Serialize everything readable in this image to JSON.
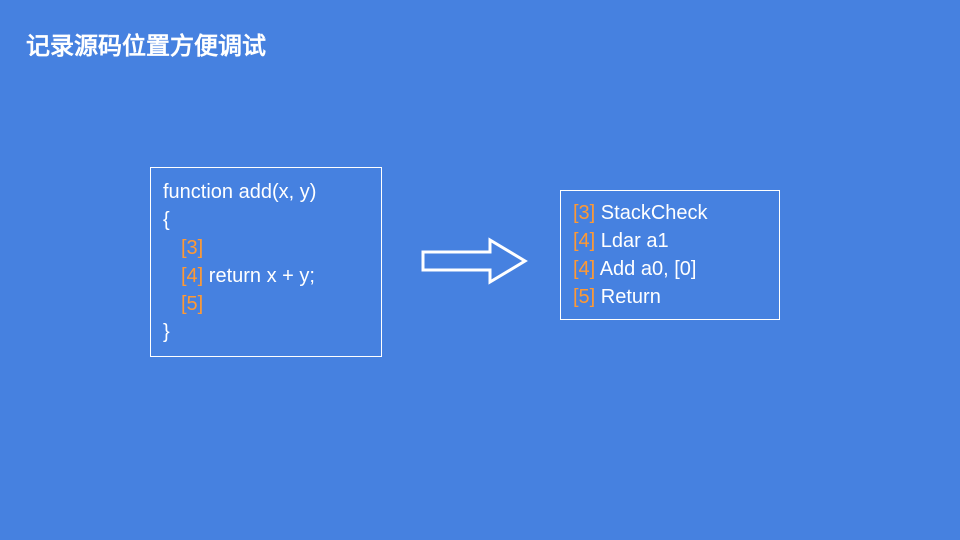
{
  "title": "记录源码位置方便调试",
  "source": {
    "line1": "function add(x, y)",
    "line2": "{",
    "line3_marker": "[3]",
    "line4_marker": "[4]",
    "line4_text": " return x + y;",
    "line5_marker": "[5]",
    "line6": "}"
  },
  "bytecode": {
    "row1_marker": "[3]",
    "row1_text": " StackCheck",
    "row2_marker": "[4]",
    "row2_text": " Ldar a1",
    "row3_marker": "[4]",
    "row3_text": " Add a0, [0]",
    "row4_marker": "[5]",
    "row4_text": " Return"
  }
}
